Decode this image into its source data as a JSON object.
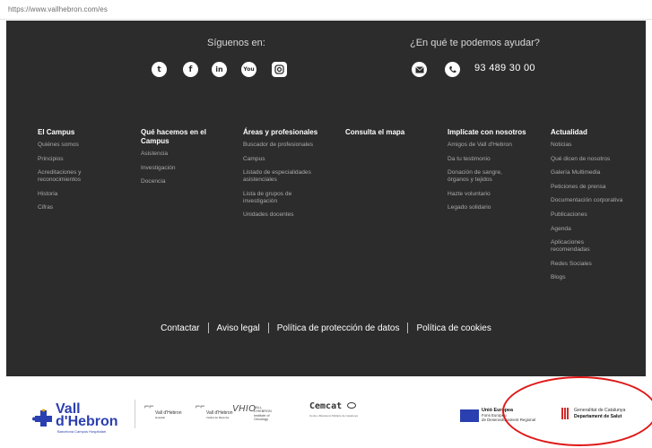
{
  "browser": {
    "url": "https://www.vallhebron.com/es"
  },
  "footer": {
    "social_title": "Síguenos en:",
    "social_icons": [
      "twitter-icon",
      "facebook-icon",
      "linkedin-icon",
      "youtube-icon",
      "instagram-icon"
    ],
    "help_title": "¿En qué te podemos ayudar?",
    "phone": "93 489 30 00",
    "columns": [
      {
        "head": "El Campus",
        "links": [
          "Quiénes somos",
          "Principios",
          "Acreditaciones y reconocimientos",
          "Historia",
          "Cifras"
        ]
      },
      {
        "head": "Qué hacemos en el Campus",
        "links": [
          "Asistencia",
          "Investigación",
          "Docencia"
        ]
      },
      {
        "head": "Áreas y profesionales",
        "links": [
          "Buscador de profesionales",
          "Campus",
          "Listado de especialidades asistenciales",
          "Lista de grupos de investigación",
          "Unidades docentes"
        ]
      },
      {
        "head": "Consulta el mapa",
        "links": []
      },
      {
        "head": "Implícate con nosotros",
        "links": [
          "Amigos de Vall d'Hebron",
          "Da tu testimonio",
          "Donación de sangre, órganos y tejidos",
          "Hazte voluntario",
          "Legado solidario"
        ]
      },
      {
        "head": "Actualidad",
        "links": [
          "Noticias",
          "Qué dicen de nosotros",
          "Galería Multimedia",
          "Peticiones de prensa",
          "Documentación corporativa",
          "Publicaciones",
          "Agenda",
          "Aplicaciones recomendadas",
          "Redes Sociales",
          "Blogs"
        ]
      }
    ],
    "legal_links": [
      "Contactar",
      "Aviso legal",
      "Política de protección de datos",
      "Política de cookies"
    ]
  },
  "logos": {
    "vall_hebron_line1": "Vall",
    "vall_hebron_line2": "d'Hebron",
    "vall_hebron_sub": "Barcelona Campus Hospitalari",
    "partner1": "Vall d'Hebron",
    "partner1_sub": "Hospital",
    "partner2": "Vall d'Hebron",
    "partner2_sub": "Institut de Recerca",
    "vhio": "VHIO",
    "vhio_sub": "VALL D'HEBRON Institute of Oncology",
    "cemcat": "Cemcat",
    "cemcat_sub": "Centre d'Esclerosi Múltiple de Catalunya",
    "eu_line1": "Unió Europea",
    "eu_line2": "Fons Europeu",
    "eu_line3": "de Desenvolupament Regional",
    "gen_line1": "Generalitat de Catalunya",
    "gen_line2": "Departament de Salut"
  },
  "colors": {
    "footer_bg": "#2c2c2c",
    "brand_blue": "#2a3fb0",
    "annotation_red": "#e01818"
  }
}
